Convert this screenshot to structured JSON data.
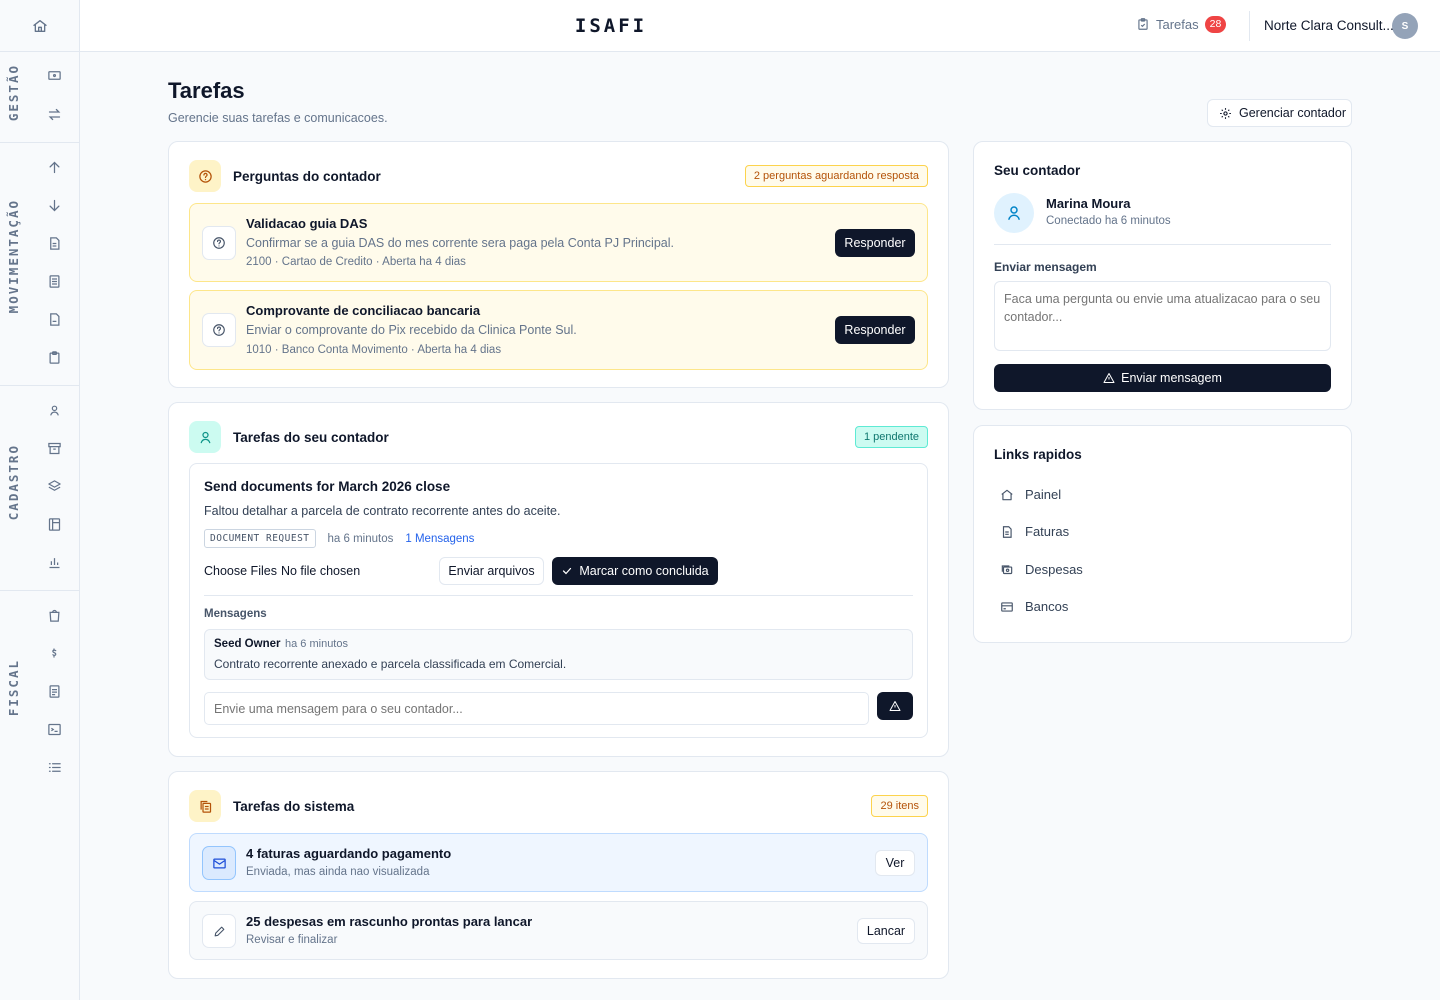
{
  "app": {
    "brand": "ISAFI"
  },
  "header": {
    "tasks_label": "Tarefas",
    "tasks_count": "28",
    "org_name": "Norte Clara Consult...",
    "avatar_initial": "S"
  },
  "sidebar": {
    "sections": [
      "GESTÃO",
      "MOVIMENTAÇÃO",
      "CADASTRO",
      "FISCAL"
    ]
  },
  "page": {
    "title": "Tarefas",
    "subtitle": "Gerencie suas tarefas e comunicacoes.",
    "manage_button": "Gerenciar contador"
  },
  "questions": {
    "title": "Perguntas do contador",
    "badge": "2 perguntas aguardando resposta",
    "items": [
      {
        "title": "Validacao guia DAS",
        "description": "Confirmar se a guia DAS do mes corrente sera paga pela Conta PJ Principal.",
        "meta": "2100 · Cartao de Credito · Aberta ha 4 dias",
        "button": "Responder"
      },
      {
        "title": "Comprovante de conciliacao bancaria",
        "description": "Enviar o comprovante do Pix recebido da Clinica Ponte Sul.",
        "meta": "1010 · Banco Conta Movimento · Aberta ha 4 dias",
        "button": "Responder"
      }
    ]
  },
  "accountant_tasks": {
    "title": "Tarefas do seu contador",
    "badge": "1 pendente",
    "task": {
      "title": "Send documents for March 2026 close",
      "description": "Faltou detalhar a parcela de contrato recorrente antes do aceite.",
      "tag": "DOCUMENT REQUEST",
      "time": "ha 6 minutos",
      "messages_link": "1 Mensagens",
      "choose_files": "Choose Files",
      "no_file": "No file chosen",
      "upload_button": "Enviar arquivos",
      "complete_button": "Marcar como concluida",
      "messages_heading": "Mensagens",
      "message": {
        "author": "Seed Owner",
        "time": "ha 6 minutos",
        "text": "Contrato recorrente anexado e parcela classificada em Comercial."
      },
      "reply_placeholder": "Envie uma mensagem para o seu contador..."
    }
  },
  "system_tasks": {
    "title": "Tarefas do sistema",
    "badge": "29 itens",
    "items": [
      {
        "title": "4 faturas aguardando pagamento",
        "subtitle": "Enviada, mas ainda nao visualizada",
        "button": "Ver"
      },
      {
        "title": "25 despesas em rascunho prontas para lancar",
        "subtitle": "Revisar e finalizar",
        "button": "Lancar"
      }
    ]
  },
  "accountant": {
    "heading": "Seu contador",
    "name": "Marina Moura",
    "status": "Conectado ha 6 minutos",
    "message_label": "Enviar mensagem",
    "message_placeholder": "Faca uma pergunta ou envie uma atualizacao para o seu contador...",
    "send_button": "Enviar mensagem"
  },
  "quick_links": {
    "heading": "Links rapidos",
    "items": [
      {
        "label": "Painel",
        "icon": "home-icon"
      },
      {
        "label": "Faturas",
        "icon": "file-icon"
      },
      {
        "label": "Despesas",
        "icon": "receipt-icon"
      },
      {
        "label": "Bancos",
        "icon": "card-icon"
      }
    ]
  },
  "colors": {
    "primary_dark": "#0f172a",
    "amber_bg": "#fffbeb",
    "teal_bg": "#ccfbf1",
    "blue_bg": "#eff6ff",
    "badge_red": "#ef4444"
  }
}
